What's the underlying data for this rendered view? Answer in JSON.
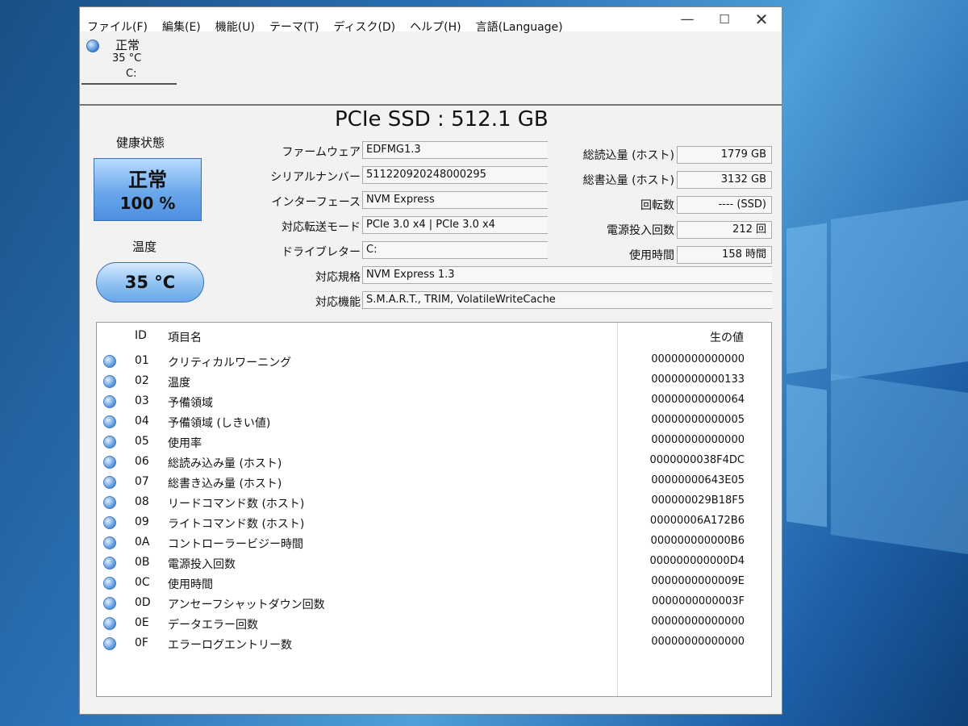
{
  "window": {
    "controls": {
      "minimize": "—",
      "maximize": "☐",
      "close": "✕"
    }
  },
  "menu": [
    "ファイル(F)",
    "編集(E)",
    "機能(U)",
    "テーマ(T)",
    "ディスク(D)",
    "ヘルプ(H)",
    "言語(Language)"
  ],
  "drive_tab": {
    "status": "正常",
    "temp": "35 °C",
    "letter": "C:"
  },
  "model": "PCIe SSD : 512.1 GB",
  "health": {
    "label": "健康状態",
    "status": "正常",
    "percent": "100 %"
  },
  "temperature": {
    "label": "温度",
    "value": "35 °C"
  },
  "info": [
    {
      "label": "ファームウェア",
      "value": "EDFMG1.3"
    },
    {
      "label": "シリアルナンバー",
      "value": "511220920248000295"
    },
    {
      "label": "インターフェース",
      "value": "NVM Express"
    },
    {
      "label": "対応転送モード",
      "value": "PCIe 3.0 x4 | PCIe 3.0 x4"
    },
    {
      "label": "ドライブレター",
      "value": "C:"
    },
    {
      "label": "対応規格",
      "value": "NVM Express 1.3"
    },
    {
      "label": "対応機能",
      "value": "S.M.A.R.T., TRIM, VolatileWriteCache"
    }
  ],
  "stats": [
    {
      "label": "総読込量 (ホスト)",
      "value": "1779 GB"
    },
    {
      "label": "総書込量 (ホスト)",
      "value": "3132 GB"
    },
    {
      "label": "回転数",
      "value": "---- (SSD)"
    },
    {
      "label": "電源投入回数",
      "value": "212 回"
    },
    {
      "label": "使用時間",
      "value": "158 時間"
    }
  ],
  "smart": {
    "headers": {
      "id": "ID",
      "name": "項目名",
      "raw": "生の値"
    },
    "rows": [
      {
        "id": "01",
        "name": "クリティカルワーニング",
        "raw": "00000000000000"
      },
      {
        "id": "02",
        "name": "温度",
        "raw": "00000000000133"
      },
      {
        "id": "03",
        "name": "予備領域",
        "raw": "00000000000064"
      },
      {
        "id": "04",
        "name": "予備領域 (しきい値)",
        "raw": "00000000000005"
      },
      {
        "id": "05",
        "name": "使用率",
        "raw": "00000000000000"
      },
      {
        "id": "06",
        "name": "総読み込み量 (ホスト)",
        "raw": "0000000038F4DC"
      },
      {
        "id": "07",
        "name": "総書き込み量 (ホスト)",
        "raw": "00000000643E05"
      },
      {
        "id": "08",
        "name": "リードコマンド数 (ホスト)",
        "raw": "000000029B18F5"
      },
      {
        "id": "09",
        "name": "ライトコマンド数 (ホスト)",
        "raw": "00000006A172B6"
      },
      {
        "id": "0A",
        "name": "コントローラービジー時間",
        "raw": "000000000000B6"
      },
      {
        "id": "0B",
        "name": "電源投入回数",
        "raw": "000000000000D4"
      },
      {
        "id": "0C",
        "name": "使用時間",
        "raw": "0000000000009E"
      },
      {
        "id": "0D",
        "name": "アンセーフシャットダウン回数",
        "raw": "0000000000003F"
      },
      {
        "id": "0E",
        "name": "データエラー回数",
        "raw": "00000000000000"
      },
      {
        "id": "0F",
        "name": "エラーログエントリー数",
        "raw": "00000000000000"
      }
    ]
  }
}
